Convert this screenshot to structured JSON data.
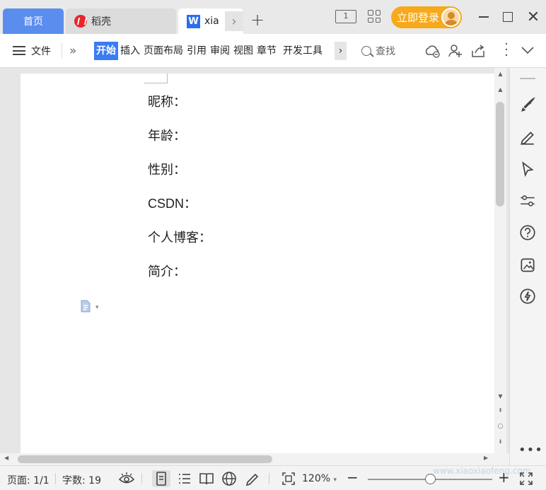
{
  "titlebar": {
    "tabs": [
      {
        "label": "首页"
      },
      {
        "label": "稻壳"
      },
      {
        "label": "xia"
      }
    ],
    "page_indicator": "1",
    "login_label": "立即登录"
  },
  "ribbon": {
    "file_label": "文件",
    "tabs": [
      "开始",
      "插入",
      "页面布局",
      "引用",
      "审阅",
      "视图",
      "章节",
      "开发工具"
    ],
    "search_label": "查找"
  },
  "document": {
    "lines": [
      "昵称：",
      "年龄：",
      "性别：",
      "CSDN：",
      "个人博客：",
      "简介："
    ]
  },
  "statusbar": {
    "page_info": "页面: 1/1",
    "word_count": "字数: 19",
    "zoom": "120%",
    "zoom_level": 0.5,
    "watermark": "www.xiaoxiaofeng.com"
  },
  "colors": {
    "home_tab": "#5b8def",
    "active_tab": "#3b7cf3",
    "login_button": "#f6a91a",
    "daoke_logo": "#e8262b"
  },
  "icons": [
    "rocket-icon",
    "pen-icon",
    "cursor-icon",
    "sliders-icon",
    "help-icon",
    "gallery-icon",
    "lightning-icon"
  ]
}
